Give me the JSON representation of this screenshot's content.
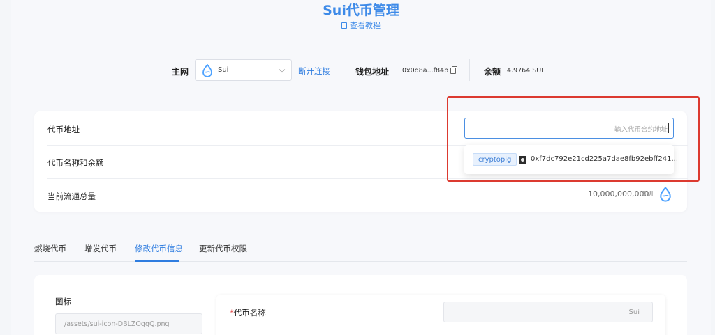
{
  "header": {
    "title": "Sui代币管理",
    "tutorial_link": "查看教程"
  },
  "network_bar": {
    "network_label": "主网",
    "network_value": "Sui",
    "disconnect_link": "断开连接",
    "wallet_label": "钱包地址",
    "wallet_address": "0x0d8a...f84b",
    "balance_label": "余额",
    "balance_value": "4.9764 SUI"
  },
  "token_card": {
    "address_label": "代币地址",
    "address_placeholder": "输入代币合约地址",
    "name_balance_label": "代币名称和余额",
    "supply_label": "当前流通总量",
    "supply_value": "10,000,000,000",
    "supply_unit": "SUI"
  },
  "dropdown": {
    "tag": "cryptopig",
    "address": "0xf7dc792e21cd225a7dae8fb92ebff241..."
  },
  "tabs": [
    {
      "label": "燃烧代币"
    },
    {
      "label": "增发代币"
    },
    {
      "label": "修改代币信息"
    },
    {
      "label": "更新代币权限"
    }
  ],
  "edit_form": {
    "icon_label": "图标",
    "icon_value": "/assets/sui-icon-DBLZOgqQ.png",
    "name_required_mark": "*",
    "name_label": "代币名称",
    "name_value": "Sui"
  },
  "colors": {
    "accent": "#2f7de0",
    "highlight": "#dc3a30",
    "sui_logo": "#4da2ff"
  }
}
